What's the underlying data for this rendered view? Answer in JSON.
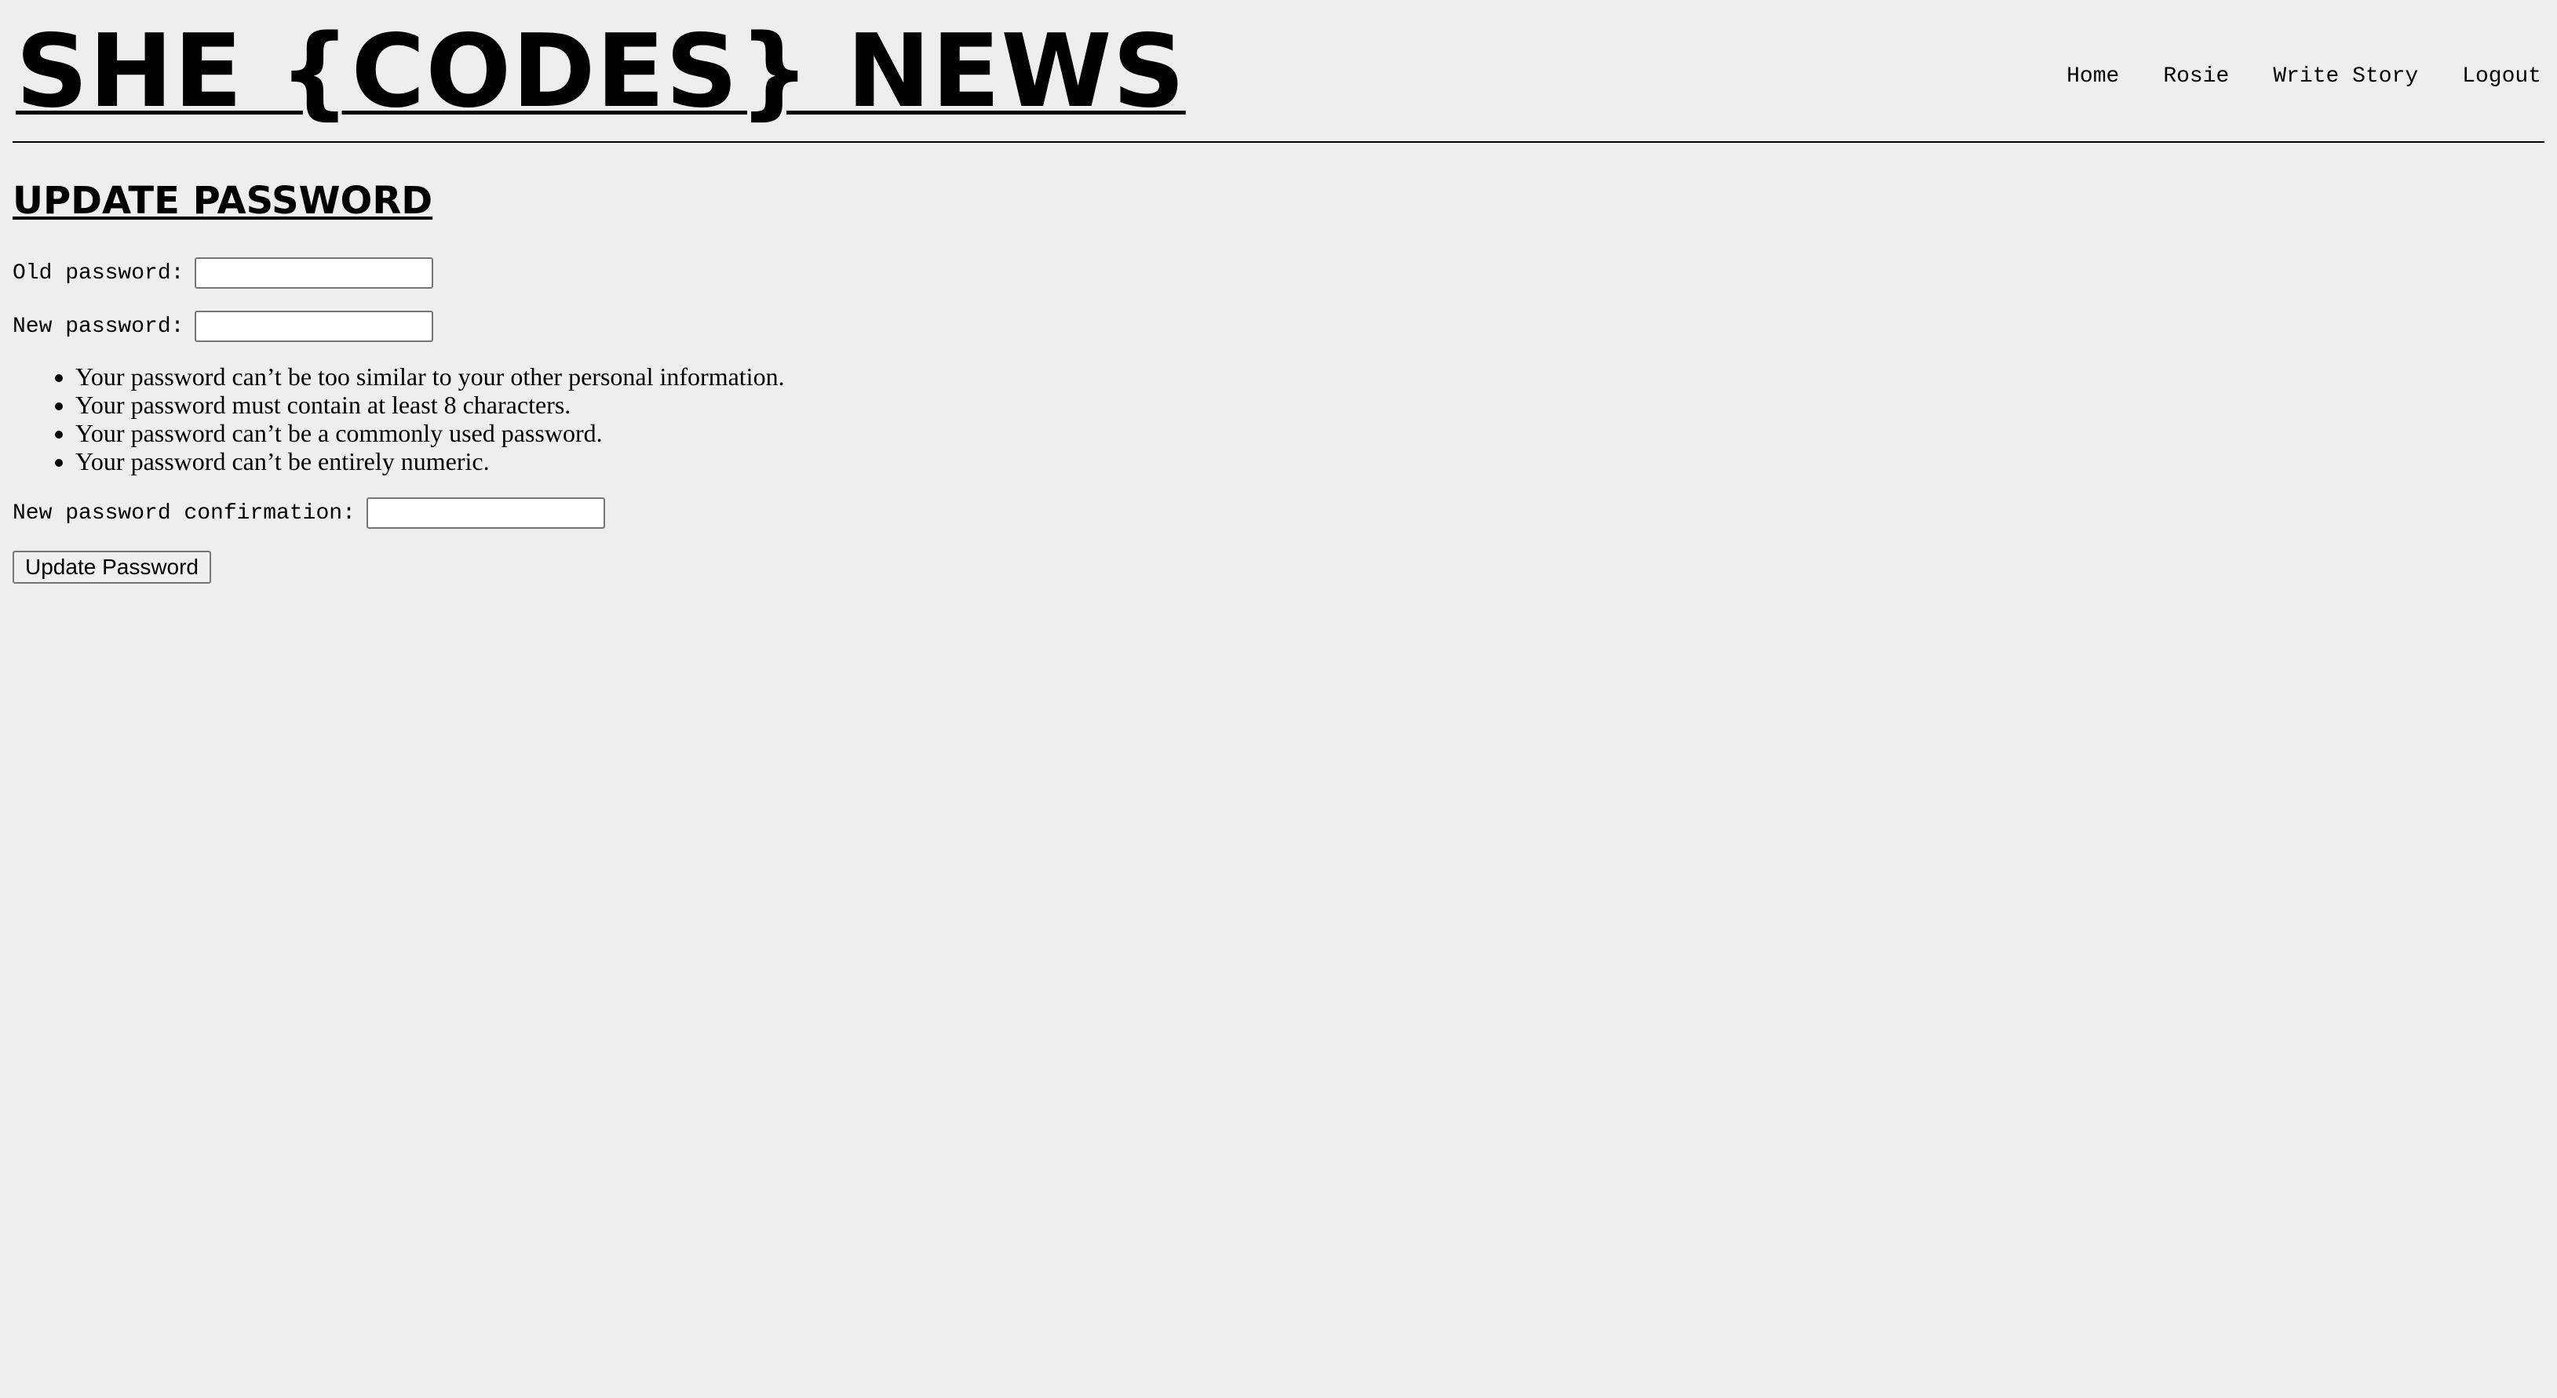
{
  "header": {
    "site_title": "SHE {CODES} NEWS",
    "nav": [
      {
        "label": "Home"
      },
      {
        "label": "Rosie"
      },
      {
        "label": "Write Story"
      },
      {
        "label": "Logout"
      }
    ]
  },
  "main": {
    "heading": "UPDATE PASSWORD",
    "form": {
      "old_password_label": "Old password:",
      "old_password_value": "",
      "new_password_label": "New password:",
      "new_password_value": "",
      "help_items": [
        "Your password can’t be too similar to your other personal information.",
        "Your password must contain at least 8 characters.",
        "Your password can’t be a commonly used password.",
        "Your password can’t be entirely numeric."
      ],
      "confirm_label": "New password confirmation:",
      "confirm_value": "",
      "submit_label": "Update Password"
    }
  },
  "colors": {
    "background": "#eeeeee",
    "text": "#000000"
  }
}
